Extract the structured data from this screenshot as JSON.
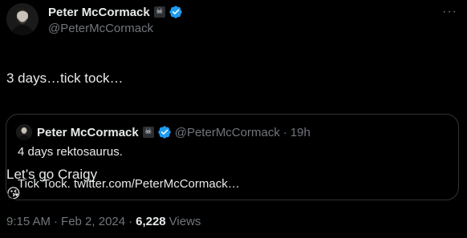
{
  "author": {
    "name": "Peter McCormack",
    "badge_emoji": "☠",
    "handle": "@PeterMcCormack"
  },
  "tweet": {
    "line1": "3 days…tick tock…",
    "line2": "Let’s go Craigy",
    "emoji": "😘"
  },
  "quote": {
    "name": "Peter McCormack",
    "badge_emoji": "☠",
    "handle": "@PeterMcCormack",
    "separator": "·",
    "age": "19h",
    "text": "4 days rektosaurus.\n\nTick Tock. twitter.com/PeterMcCormack…"
  },
  "meta": {
    "time": "9:15 AM",
    "separator1": "·",
    "date": "Feb 2, 2024",
    "separator2": "·",
    "views_count": "6,228",
    "views_label": "Views"
  },
  "colors": {
    "background": "#000000",
    "text": "#e7e9ea",
    "muted": "#71767b",
    "border": "#2f3336",
    "verified": "#1d9bf0"
  },
  "icons": {
    "more": "more-options-icon",
    "verified": "verified-badge-icon"
  }
}
